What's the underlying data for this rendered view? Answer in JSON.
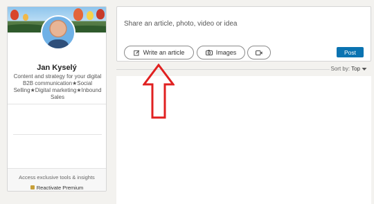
{
  "profile": {
    "name": "Jan Kyselý",
    "headline": "Content and strategy for your digital B2B communication★Social Selling★Digital marketing★Inbound Sales",
    "premium_text": "Access exclusive tools & insights",
    "premium_link": "Reactivate Premium"
  },
  "share": {
    "placeholder": "Share an article, photo, video or idea",
    "write_article": "Write an article",
    "images": "Images",
    "post": "Post"
  },
  "sort": {
    "label": "Sort by:",
    "value": "Top"
  },
  "colors": {
    "accent": "#0a73b1",
    "arrow": "#e02020",
    "premium": "#c7a03a"
  },
  "icons": [
    "edit-icon",
    "camera-icon",
    "video-icon",
    "caret-down-icon",
    "red-arrow-up-icon"
  ]
}
